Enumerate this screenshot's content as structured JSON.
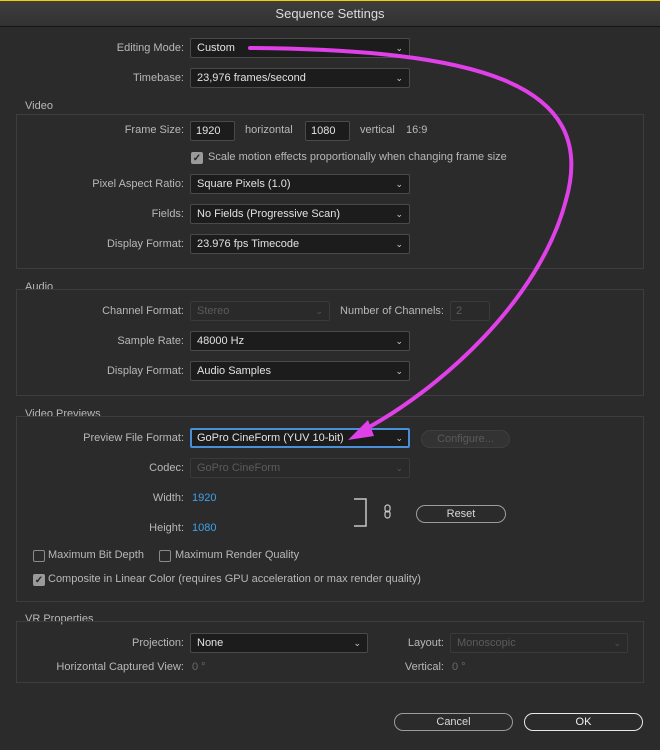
{
  "window": {
    "title": "Sequence Settings"
  },
  "general": {
    "editing_mode_label": "Editing Mode:",
    "editing_mode_value": "Custom",
    "timebase_label": "Timebase:",
    "timebase_value": "23,976  frames/second"
  },
  "video": {
    "title": "Video",
    "frame_size_label": "Frame Size:",
    "frame_width": "1920",
    "horizontal_label": "horizontal",
    "frame_height": "1080",
    "vertical_label": "vertical",
    "aspect": "16:9",
    "scale_motion_label": "Scale motion effects proportionally when changing frame size",
    "scale_motion_checked": true,
    "par_label": "Pixel Aspect Ratio:",
    "par_value": "Square Pixels (1.0)",
    "fields_label": "Fields:",
    "fields_value": "No Fields (Progressive Scan)",
    "display_format_label": "Display Format:",
    "display_format_value": "23.976 fps Timecode"
  },
  "audio": {
    "title": "Audio",
    "channel_format_label": "Channel Format:",
    "channel_format_value": "Stereo",
    "num_channels_label": "Number of Channels:",
    "num_channels_value": "2",
    "sample_rate_label": "Sample Rate:",
    "sample_rate_value": "48000 Hz",
    "display_format_label": "Display Format:",
    "display_format_value": "Audio Samples"
  },
  "previews": {
    "title": "Video Previews",
    "file_format_label": "Preview File Format:",
    "file_format_value": "GoPro CineForm (YUV 10-bit)",
    "configure_label": "Configure...",
    "codec_label": "Codec:",
    "codec_value": "GoPro CineForm",
    "width_label": "Width:",
    "width_value": "1920",
    "height_label": "Height:",
    "height_value": "1080",
    "reset_label": "Reset",
    "max_bit_depth_label": "Maximum Bit Depth",
    "max_render_quality_label": "Maximum Render Quality",
    "linear_color_label": "Composite in Linear Color (requires GPU acceleration or max render quality)"
  },
  "vr": {
    "title": "VR Properties",
    "projection_label": "Projection:",
    "projection_value": "None",
    "layout_label": "Layout:",
    "layout_value": "Monoscopic",
    "h_captured_label": "Horizontal Captured View:",
    "h_captured_value": "0 °",
    "vertical_label": "Vertical:",
    "vertical_value": "0 °"
  },
  "footer": {
    "cancel_label": "Cancel",
    "ok_label": "OK"
  },
  "colors": {
    "accent": "#3ea2e8",
    "annotation": "#e040e8",
    "focus": "#4a8fd8"
  },
  "icons": {
    "dropdown": "chevron-down-icon",
    "checkmark": "checkmark-icon",
    "link": "chain-link-icon"
  }
}
